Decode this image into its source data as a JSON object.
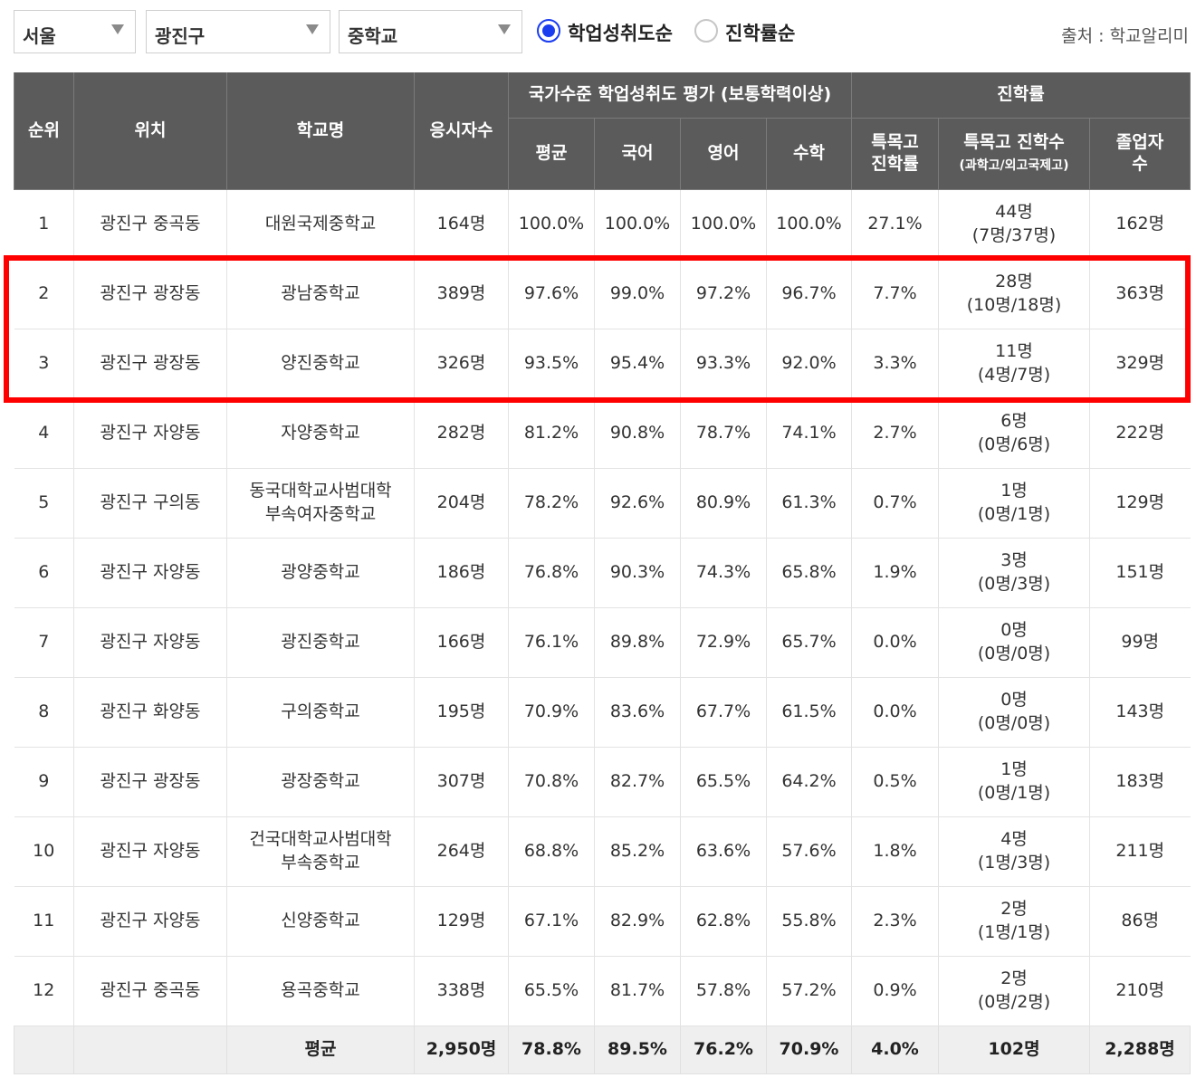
{
  "filters": {
    "region": "서울",
    "district": "광진구",
    "school_type": "중학교"
  },
  "sort": {
    "options": [
      {
        "label": "학업성취도순",
        "selected": true
      },
      {
        "label": "진학률순",
        "selected": false
      }
    ]
  },
  "source": "출처 : 학교알리미",
  "table": {
    "headers": {
      "rank": "순위",
      "location": "위치",
      "school": "학교명",
      "examinees": "응시자수",
      "assessment_group": "국가수준 학업성취도 평가 (보통학력이상)",
      "admission_group": "진학률",
      "average": "평균",
      "korean": "국어",
      "english": "영어",
      "math": "수학",
      "special_rate_line1": "특목고",
      "special_rate_line2": "진학률",
      "special_count_line1": "특목고 진학수",
      "special_count_line2": "(과학고/외고국제고)",
      "graduates_line1": "졸업자",
      "graduates_line2": "수"
    },
    "rows": [
      {
        "rank": "1",
        "location": "광진구 중곡동",
        "school_line1": "대원국제중학교",
        "school_line2": "",
        "examinees": "164명",
        "avg": "100.0%",
        "korean": "100.0%",
        "english": "100.0%",
        "math": "100.0%",
        "special_rate": "27.1%",
        "special_count": "44명",
        "special_detail": "(7명/37명)",
        "graduates": "162명"
      },
      {
        "rank": "2",
        "location": "광진구 광장동",
        "school_line1": "광남중학교",
        "school_line2": "",
        "examinees": "389명",
        "avg": "97.6%",
        "korean": "99.0%",
        "english": "97.2%",
        "math": "96.7%",
        "special_rate": "7.7%",
        "special_count": "28명",
        "special_detail": "(10명/18명)",
        "graduates": "363명"
      },
      {
        "rank": "3",
        "location": "광진구 광장동",
        "school_line1": "양진중학교",
        "school_line2": "",
        "examinees": "326명",
        "avg": "93.5%",
        "korean": "95.4%",
        "english": "93.3%",
        "math": "92.0%",
        "special_rate": "3.3%",
        "special_count": "11명",
        "special_detail": "(4명/7명)",
        "graduates": "329명"
      },
      {
        "rank": "4",
        "location": "광진구 자양동",
        "school_line1": "자양중학교",
        "school_line2": "",
        "examinees": "282명",
        "avg": "81.2%",
        "korean": "90.8%",
        "english": "78.7%",
        "math": "74.1%",
        "special_rate": "2.7%",
        "special_count": "6명",
        "special_detail": "(0명/6명)",
        "graduates": "222명"
      },
      {
        "rank": "5",
        "location": "광진구 구의동",
        "school_line1": "동국대학교사범대학",
        "school_line2": "부속여자중학교",
        "examinees": "204명",
        "avg": "78.2%",
        "korean": "92.6%",
        "english": "80.9%",
        "math": "61.3%",
        "special_rate": "0.7%",
        "special_count": "1명",
        "special_detail": "(0명/1명)",
        "graduates": "129명"
      },
      {
        "rank": "6",
        "location": "광진구 자양동",
        "school_line1": "광양중학교",
        "school_line2": "",
        "examinees": "186명",
        "avg": "76.8%",
        "korean": "90.3%",
        "english": "74.3%",
        "math": "65.8%",
        "special_rate": "1.9%",
        "special_count": "3명",
        "special_detail": "(0명/3명)",
        "graduates": "151명"
      },
      {
        "rank": "7",
        "location": "광진구 자양동",
        "school_line1": "광진중학교",
        "school_line2": "",
        "examinees": "166명",
        "avg": "76.1%",
        "korean": "89.8%",
        "english": "72.9%",
        "math": "65.7%",
        "special_rate": "0.0%",
        "special_count": "0명",
        "special_detail": "(0명/0명)",
        "graduates": "99명"
      },
      {
        "rank": "8",
        "location": "광진구 화양동",
        "school_line1": "구의중학교",
        "school_line2": "",
        "examinees": "195명",
        "avg": "70.9%",
        "korean": "83.6%",
        "english": "67.7%",
        "math": "61.5%",
        "special_rate": "0.0%",
        "special_count": "0명",
        "special_detail": "(0명/0명)",
        "graduates": "143명"
      },
      {
        "rank": "9",
        "location": "광진구 광장동",
        "school_line1": "광장중학교",
        "school_line2": "",
        "examinees": "307명",
        "avg": "70.8%",
        "korean": "82.7%",
        "english": "65.5%",
        "math": "64.2%",
        "special_rate": "0.5%",
        "special_count": "1명",
        "special_detail": "(0명/1명)",
        "graduates": "183명"
      },
      {
        "rank": "10",
        "location": "광진구 자양동",
        "school_line1": "건국대학교사범대학",
        "school_line2": "부속중학교",
        "examinees": "264명",
        "avg": "68.8%",
        "korean": "85.2%",
        "english": "63.6%",
        "math": "57.6%",
        "special_rate": "1.8%",
        "special_count": "4명",
        "special_detail": "(1명/3명)",
        "graduates": "211명"
      },
      {
        "rank": "11",
        "location": "광진구 자양동",
        "school_line1": "신양중학교",
        "school_line2": "",
        "examinees": "129명",
        "avg": "67.1%",
        "korean": "82.9%",
        "english": "62.8%",
        "math": "55.8%",
        "special_rate": "2.3%",
        "special_count": "2명",
        "special_detail": "(1명/1명)",
        "graduates": "86명"
      },
      {
        "rank": "12",
        "location": "광진구 중곡동",
        "school_line1": "용곡중학교",
        "school_line2": "",
        "examinees": "338명",
        "avg": "65.5%",
        "korean": "81.7%",
        "english": "57.8%",
        "math": "57.2%",
        "special_rate": "0.9%",
        "special_count": "2명",
        "special_detail": "(0명/2명)",
        "graduates": "210명"
      }
    ],
    "footer": {
      "label": "평균",
      "examinees": "2,950명",
      "avg": "78.8%",
      "korean": "89.5%",
      "english": "76.2%",
      "math": "70.9%",
      "special_rate": "4.0%",
      "special_count": "102명",
      "graduates": "2,288명"
    }
  },
  "highlight": {
    "color": "#ff0000",
    "rows": [
      "2",
      "3"
    ]
  },
  "colors": {
    "header_bg": "#5b5b5b",
    "radio_accent": "#1a3df0",
    "footer_bg": "#efefef"
  }
}
